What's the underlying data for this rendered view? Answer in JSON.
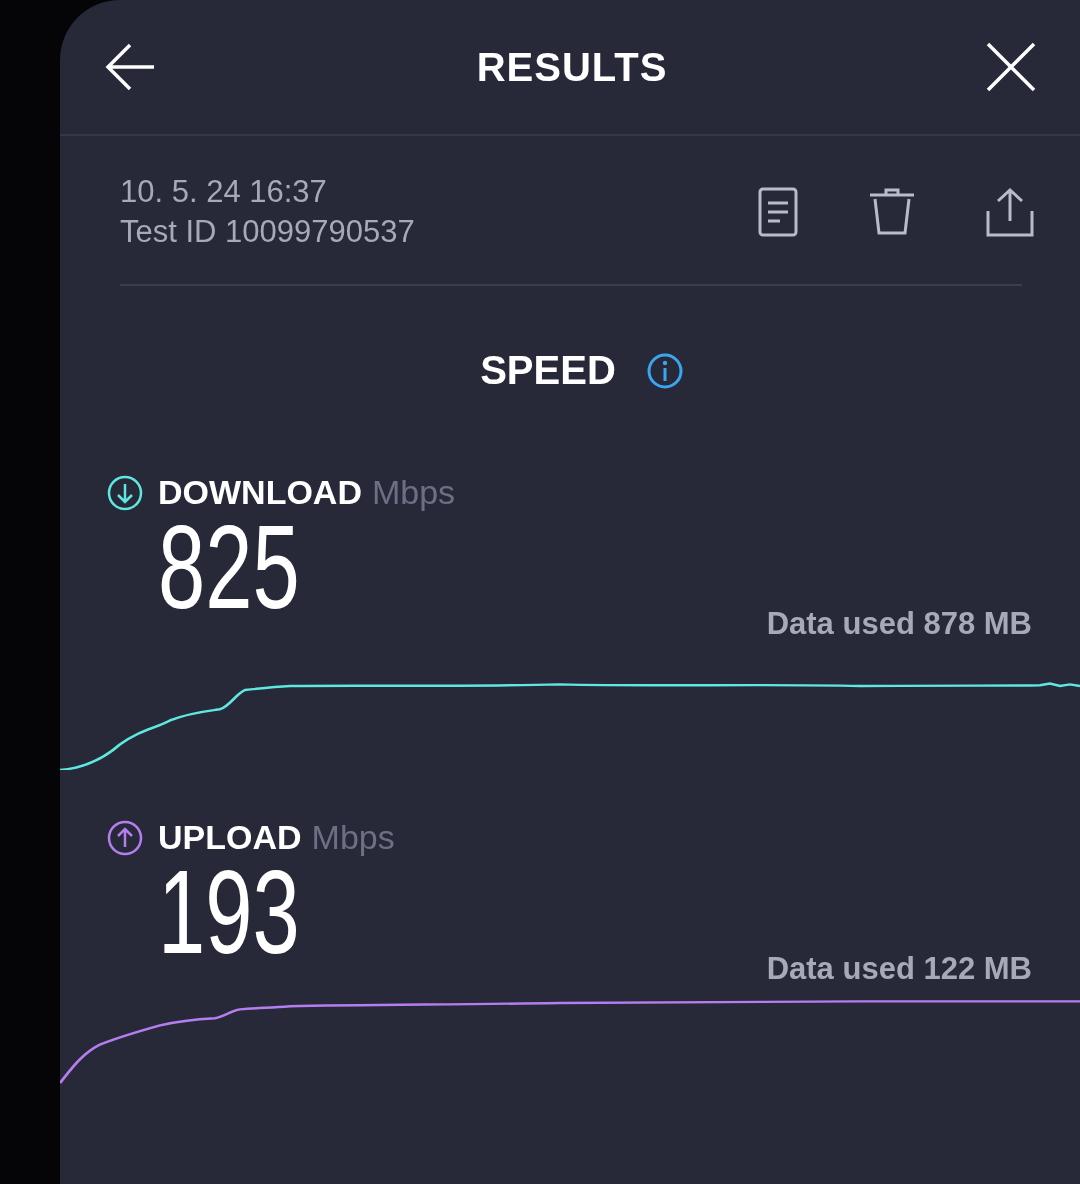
{
  "header": {
    "title": "RESULTS"
  },
  "test": {
    "datetime": "10. 5. 24 16:37",
    "test_id": "Test ID 10099790537"
  },
  "section": {
    "title": "SPEED"
  },
  "metrics": [
    {
      "kind": "download",
      "label": "DOWNLOAD",
      "unit": "Mbps",
      "value": "825",
      "data_used": "Data used 878 MB",
      "color": "#5ee8e0"
    },
    {
      "kind": "upload",
      "label": "UPLOAD",
      "unit": "Mbps",
      "value": "193",
      "data_used": "Data used 122 MB",
      "color": "#b57ef0"
    }
  ]
}
